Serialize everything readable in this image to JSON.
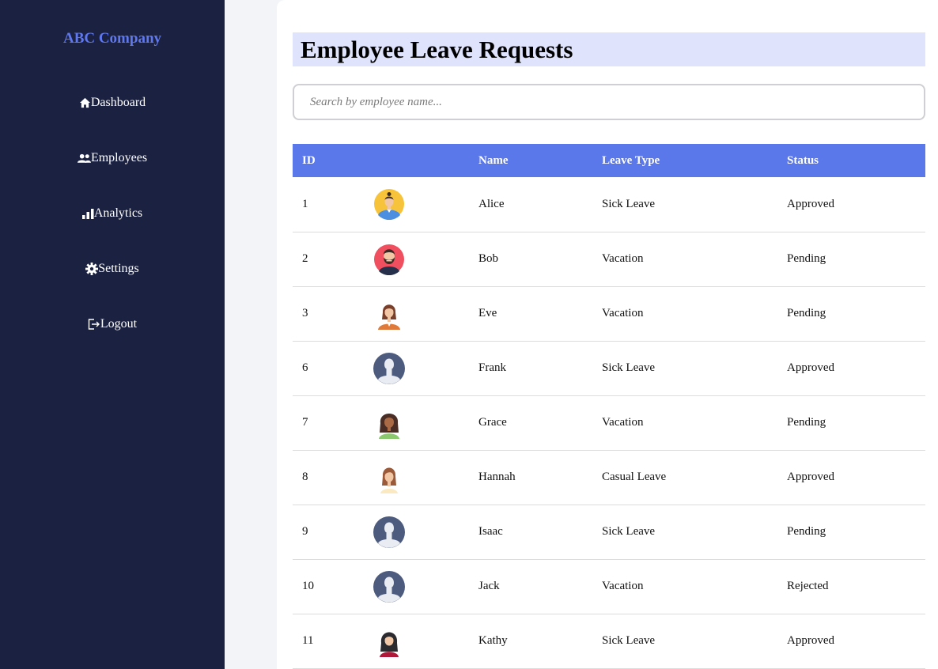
{
  "sidebar": {
    "brand": "ABC Company",
    "items": [
      {
        "label": "Dashboard",
        "icon": "home-icon"
      },
      {
        "label": "Employees",
        "icon": "users-icon"
      },
      {
        "label": "Analytics",
        "icon": "chart-bar-icon"
      },
      {
        "label": "Settings",
        "icon": "gear-icon"
      },
      {
        "label": "Logout",
        "icon": "logout-icon"
      }
    ]
  },
  "main": {
    "title": "Employee Leave Requests",
    "search": {
      "placeholder": "Search by employee name...",
      "value": ""
    },
    "table": {
      "headers": [
        "ID",
        "",
        "Name",
        "Leave Type",
        "Status"
      ],
      "rows": [
        {
          "id": "1",
          "avatar": "avatar-man-bun",
          "name": "Alice",
          "leave_type": "Sick Leave",
          "status": "Approved"
        },
        {
          "id": "2",
          "avatar": "avatar-bearded-man",
          "name": "Bob",
          "leave_type": "Vacation",
          "status": "Pending"
        },
        {
          "id": "3",
          "avatar": "avatar-woman-orange",
          "name": "Eve",
          "leave_type": "Vacation",
          "status": "Pending"
        },
        {
          "id": "6",
          "avatar": "avatar-default",
          "name": "Frank",
          "leave_type": "Sick Leave",
          "status": "Approved"
        },
        {
          "id": "7",
          "avatar": "avatar-woman-curly",
          "name": "Grace",
          "leave_type": "Vacation",
          "status": "Pending"
        },
        {
          "id": "8",
          "avatar": "avatar-woman-auburn",
          "name": "Hannah",
          "leave_type": "Casual Leave",
          "status": "Approved"
        },
        {
          "id": "9",
          "avatar": "avatar-default",
          "name": "Isaac",
          "leave_type": "Sick Leave",
          "status": "Pending"
        },
        {
          "id": "10",
          "avatar": "avatar-default",
          "name": "Jack",
          "leave_type": "Vacation",
          "status": "Rejected"
        },
        {
          "id": "11",
          "avatar": "avatar-woman-hijab",
          "name": "Kathy",
          "leave_type": "Sick Leave",
          "status": "Approved"
        }
      ]
    }
  },
  "colors": {
    "sidebar_bg": "#1b2140",
    "brand": "#5f78ee",
    "header_bg": "#5b78ea",
    "title_bg": "#dfe3fb"
  }
}
